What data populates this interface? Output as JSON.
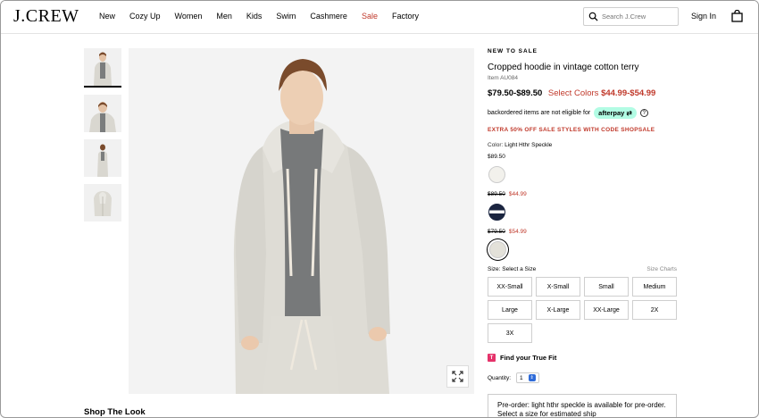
{
  "header": {
    "logo": "J.CREW",
    "nav": [
      "New",
      "Cozy Up",
      "Women",
      "Men",
      "Kids",
      "Swim",
      "Cashmere",
      "Sale",
      "Factory"
    ],
    "search_placeholder": "Search J.Crew",
    "signin": "Sign In"
  },
  "product": {
    "badge": "NEW TO SALE",
    "title": "Cropped hoodie in vintage cotton terry",
    "item_no": "Item AU084",
    "price_range": "$79.50-$89.50",
    "select_colors_label": "Select Colors",
    "select_colors_price": "$44.99-$54.99",
    "backorder_note": "backordered items are not eligible for",
    "afterpay_label": "afterpay",
    "promo": "EXTRA 50% OFF SALE STYLES WITH CODE SHOPSALE",
    "color_label": "Color:",
    "color_value": "Light Hthr Speckle",
    "swatch_groups": [
      {
        "was": "",
        "now": "$89.50",
        "colors": [
          "#f2f1ec"
        ]
      },
      {
        "was": "$89.50",
        "now": "$44.99",
        "colors": [
          "#1b2540"
        ]
      },
      {
        "was": "$79.50",
        "now": "$54.99",
        "colors": [
          "#e3e1d9"
        ]
      }
    ],
    "size_label": "Size:",
    "size_value": "Select a Size",
    "size_charts": "Size Charts",
    "sizes": [
      "XX-Small",
      "X-Small",
      "Small",
      "Medium",
      "Large",
      "X-Large",
      "XX-Large",
      "2X",
      "3X"
    ],
    "true_fit": "Find your True Fit",
    "quantity_label": "Quantity:",
    "quantity_value": "1",
    "preorder_text": "Pre-order: light hthr speckle is available for pre-order. Select a size for estimated ship"
  },
  "shop_the_look": "Shop The Look",
  "colors": {
    "sale_red": "#c0392b",
    "afterpay_mint": "#b2fce4",
    "truefit_pink": "#e5326a"
  }
}
